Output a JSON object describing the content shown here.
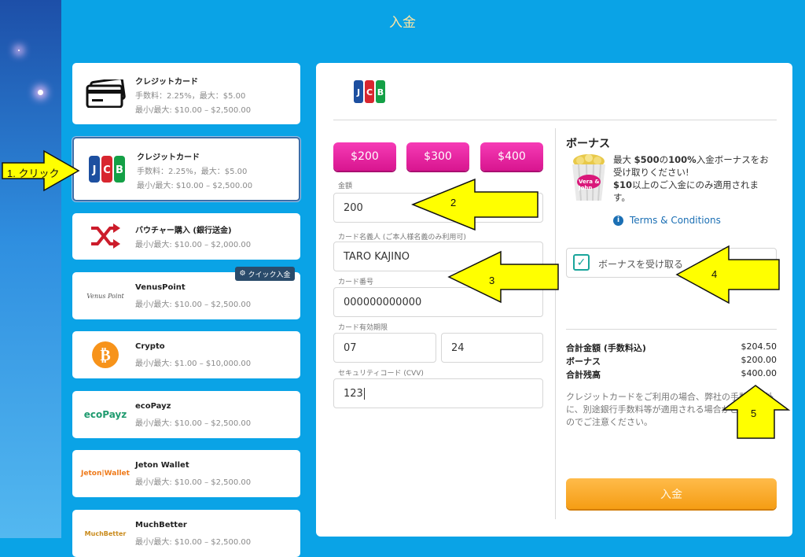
{
  "page": {
    "title": "入金"
  },
  "methods": [
    {
      "name": "クレジットカード",
      "line1": "手数料：2.25%，最大：$5.00",
      "line2": "最小/最大: $10.00 – $2,500.00"
    },
    {
      "name": "クレジットカード",
      "line1": "手数料：2.25%，最大：$5.00",
      "line2": "最小/最大: $10.00 – $2,500.00"
    },
    {
      "name": "バウチャー購入 (銀行送金)",
      "line1": "最小/最大: $10.00 – $2,000.00"
    },
    {
      "name": "VenusPoint",
      "line1": "最小/最大: $10.00 – $2,500.00",
      "logo_text": "Venus Point"
    },
    {
      "name": "Crypto",
      "line1": "最小/最大: $1.00 – $10,000.00"
    },
    {
      "name": "ecoPayz",
      "line1": "最小/最大: $10.00 – $2,500.00",
      "logo_text": "ecoPayz"
    },
    {
      "name": "Jeton Wallet",
      "line1": "最小/最大: $10.00 – $2,500.00",
      "logo_text": "Jeton|Wallet"
    },
    {
      "name": "MuchBetter",
      "line1": "最小/最大: $10.00 – $2,500.00",
      "logo_text": "MuchBetter"
    }
  ],
  "quick_badge": "クイック入金",
  "selected_logo": "JCB",
  "amounts": [
    "$200",
    "$300",
    "$400"
  ],
  "form": {
    "amount_label": "金額",
    "amount_value": "200",
    "holder_label": "カード名義人 (ご本人様名義のみ利用可)",
    "holder_value": "TARO KAJINO",
    "number_label": "カード番号",
    "number_value": "000000000000",
    "expiry_label": "カード有効期限",
    "expiry_month": "07",
    "expiry_year": "24",
    "cvv_label": "セキュリティコード (CVV)",
    "cvv_value": "123"
  },
  "bonus": {
    "title": "ボーナス",
    "text_a": "最大 ",
    "text_b": "$500",
    "text_c": "の",
    "text_d": "100%",
    "text_e": "入金ボーナスを",
    "text_f": "お受け取りください!",
    "text_g": "$10",
    "text_h": "以上のご入金にのみ適用されます。",
    "image_text": "Vera & John",
    "terms": "Terms & Conditions",
    "checkbox_label": "ボーナスを受け取る"
  },
  "summary": [
    {
      "label": "合計金額 (手数料込)",
      "value": "$204.50"
    },
    {
      "label": "ボーナス",
      "value": "$200.00"
    },
    {
      "label": "合計残高",
      "value": "$400.00"
    }
  ],
  "note": "クレジットカードをご利用の場合、弊社の手数料以外に、別途銀行手数料等が適用される場合がございますのでご注意ください。",
  "submit": "入金",
  "annotations": [
    "1. クリック",
    "2",
    "3",
    "4",
    "5"
  ],
  "colors": {
    "background": "#0aa3e6",
    "pink": "#e8219f",
    "orange": "#f7a81f",
    "arrow": "#ffff00"
  }
}
